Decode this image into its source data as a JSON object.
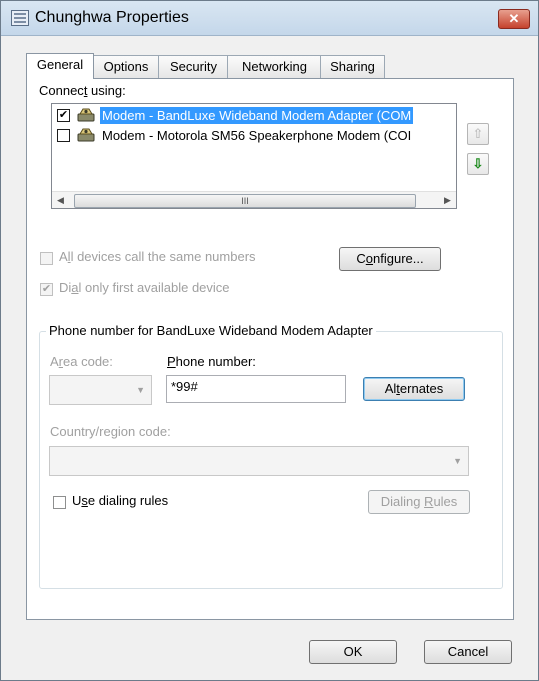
{
  "window": {
    "title": "Chunghwa Properties",
    "close_glyph": "✕"
  },
  "tabs": [
    {
      "label": "General",
      "active": true
    },
    {
      "label": "Options",
      "active": false
    },
    {
      "label": "Security",
      "active": false
    },
    {
      "label": "Networking",
      "active": false
    },
    {
      "label": "Sharing",
      "active": false
    }
  ],
  "connect_using": {
    "label_pre": "Connec",
    "label_ul": "t",
    "label_post": " using:",
    "devices": [
      {
        "label": "Modem - BandLuxe Wideband Modem Adapter (COM",
        "checked": true,
        "selected": true
      },
      {
        "label": "Modem - Motorola SM56 Speakerphone Modem (COI",
        "checked": false,
        "selected": false
      }
    ],
    "scroll_thumb_grip": "III",
    "scroll_left": "◀",
    "scroll_right": "▶",
    "move_up_glyph": "⇧",
    "move_down_glyph": "⇩"
  },
  "options": {
    "all_devices": {
      "pre": "A",
      "ul": "l",
      "post": "l devices call the same numbers",
      "checked": false,
      "enabled": false
    },
    "dial_first": {
      "pre": "Di",
      "ul": "a",
      "post": "l only first available device",
      "checked": true,
      "enabled": false
    },
    "configure": {
      "pre": "C",
      "ul": "o",
      "post": "nfigure..."
    }
  },
  "phone_group": {
    "title": "Phone number for BandLuxe Wideband Modem Adapter",
    "area_code_label": {
      "pre": "A",
      "ul": "r",
      "post": "ea code:"
    },
    "area_code_value": "",
    "phone_number_label": {
      "ul": "P",
      "post": "hone number:"
    },
    "phone_number_value": "*99#",
    "alternates": {
      "pre": "Al",
      "ul": "t",
      "post": "ernates"
    },
    "country_label": "Country/region code:",
    "country_value": "",
    "use_dialing_rules": {
      "pre": "U",
      "ul": "s",
      "post": "e dialing rules",
      "checked": false
    },
    "dialing_rules": {
      "pre": "Dialing ",
      "ul": "R",
      "post": "ules"
    }
  },
  "footer": {
    "ok": "OK",
    "cancel": "Cancel"
  },
  "colors": {
    "selection": "#3399ff",
    "window_bg": "#f0f0f0",
    "panel_bg": "#ffffff",
    "close_red": "#c5422d"
  }
}
